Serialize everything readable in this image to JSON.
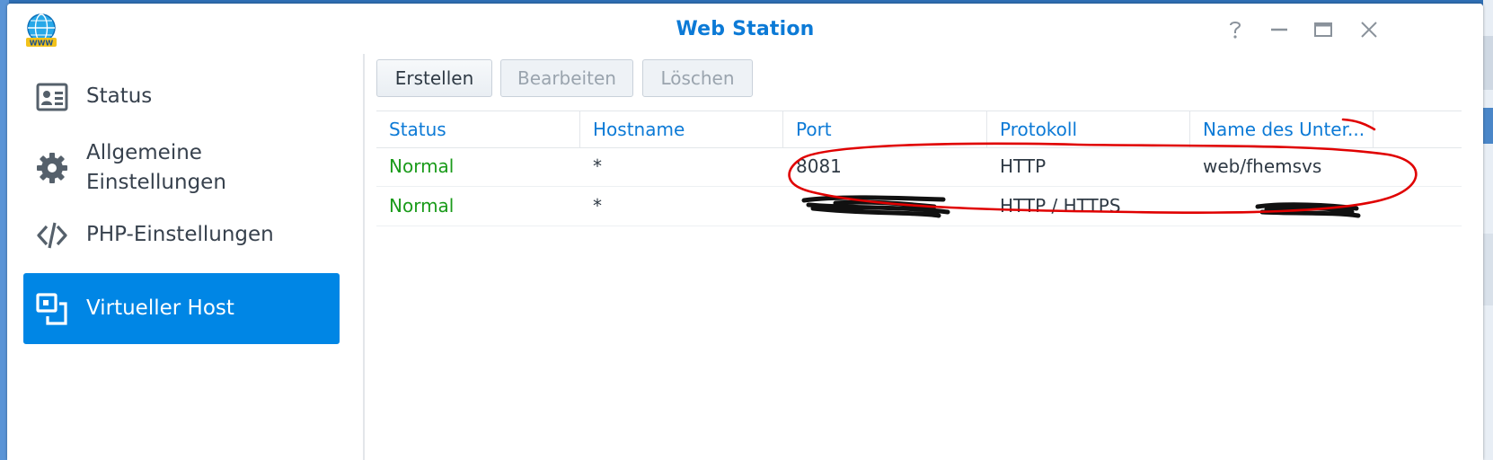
{
  "window": {
    "title": "Web Station"
  },
  "sidebar": {
    "items": [
      {
        "label": "Status",
        "icon": "status-card-icon"
      },
      {
        "label": "Allgemeine Einstellungen",
        "icon": "gear-icon"
      },
      {
        "label": "PHP-Einstellungen",
        "icon": "code-icon"
      },
      {
        "label": "Virtueller Host",
        "icon": "virtual-host-icon",
        "active": true
      }
    ]
  },
  "toolbar": {
    "create_label": "Erstellen",
    "edit_label": "Bearbeiten",
    "delete_label": "Löschen"
  },
  "table": {
    "columns": [
      "Status",
      "Hostname",
      "Port",
      "Protokoll",
      "Name des Unter..."
    ],
    "rows": [
      [
        "Normal",
        "*",
        "8081",
        "HTTP",
        "web/fhemsvs"
      ],
      [
        "Normal",
        "*",
        "",
        "HTTP / HTTPS",
        ""
      ]
    ]
  },
  "colors": {
    "accent": "#0c7ad6",
    "active_nav": "#0086e5",
    "status_ok": "#1a9b1a",
    "annotation": "#e00000",
    "redaction": "#000000"
  }
}
